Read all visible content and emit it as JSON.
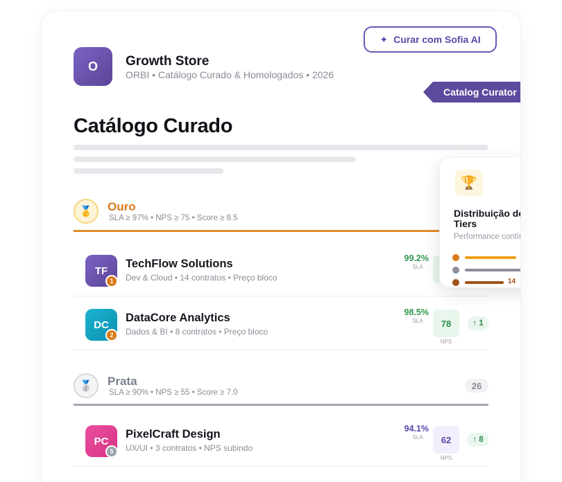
{
  "header": {
    "ai_button_label": "Curar com Sofia AI",
    "ai_button_icon": "sparkle-icon",
    "store_logo_letter": "O",
    "store_name": "Growth Store",
    "store_subtitle": "ORBI • Catálogo Curado & Homologados • 2026",
    "curator_tag": "Catalog Curator"
  },
  "page_title": "Catálogo Curado",
  "tiers": [
    {
      "name": "Ouro",
      "medal_icon": "gold-medal-icon",
      "criteria": "SLA ≥ 97% • NPS ≥ 75 • Score ≥ 8.5",
      "color": "#d97a1a",
      "vendors": [
        {
          "initials": "TF",
          "rank": "1",
          "name": "TechFlow Solutions",
          "subtitle": "Dev & Cloud • 14 contratos • Preço bloco",
          "sla": "99.2%",
          "sla_label": "SLA",
          "nps": "",
          "nps_label": "",
          "trend": ""
        },
        {
          "initials": "DC",
          "rank": "2",
          "name": "DataCore Analytics",
          "subtitle": "Dados & BI • 8 contratos • Preço bloco",
          "sla": "98.5%",
          "sla_label": "SLA",
          "nps": "78",
          "nps_label": "NPS",
          "trend": "↑ 1"
        }
      ]
    },
    {
      "name": "Prata",
      "medal_icon": "silver-medal-icon",
      "criteria": "SLA ≥ 90% • NPS ≥ 55 • Score ≥ 7.0",
      "count": "26",
      "color": "#9aa0aa",
      "vendors": [
        {
          "initials": "PC",
          "rank": "5",
          "name": "PixelCraft Design",
          "subtitle": "UX/UI • 3 contratos • NPS subindo",
          "sla": "94.1%",
          "sla_label": "SLA",
          "nps": "62",
          "nps_label": "NPS",
          "trend": "↑ 8"
        }
      ]
    }
  ],
  "popup": {
    "icon": "trophy-icon",
    "title": "Distribuição de Tiers",
    "subtitle": "Performance contínua",
    "bars": [
      {
        "color": "#d97a1a",
        "bar_color": "#f0a21a",
        "value": ""
      },
      {
        "color": "#8a8f99",
        "bar_color": "#8a8f99",
        "value": ""
      },
      {
        "color": "#a0521a",
        "bar_color": "#a0521a",
        "value": "14"
      }
    ]
  }
}
